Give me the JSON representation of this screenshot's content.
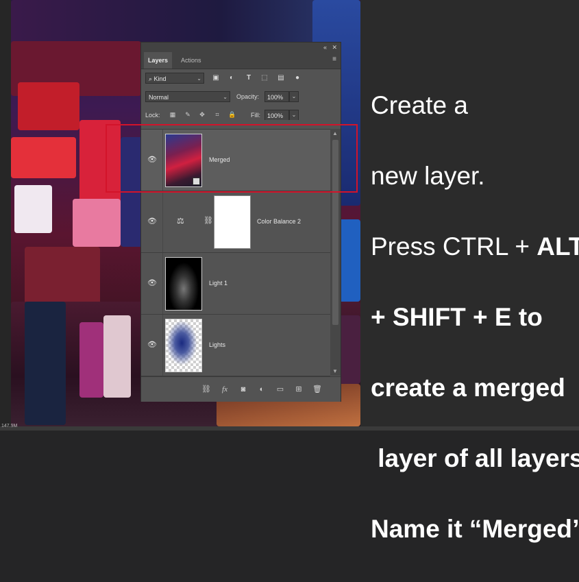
{
  "panel": {
    "tabs": [
      {
        "label": "Layers",
        "active": true
      },
      {
        "label": "Actions",
        "active": false
      }
    ],
    "filter": {
      "kind_label": "Kind"
    },
    "blend": {
      "mode": "Normal",
      "opacity_label": "Opacity:",
      "opacity_value": "100%"
    },
    "lock": {
      "label": "Lock:",
      "fill_label": "Fill:",
      "fill_value": "100%"
    },
    "layers": [
      {
        "name": "Merged",
        "selected": true,
        "visible": true
      },
      {
        "name": "Color Balance 2",
        "selected": false,
        "visible": true
      },
      {
        "name": "Light 1",
        "selected": false,
        "visible": true
      },
      {
        "name": "Lights",
        "selected": false,
        "visible": true
      }
    ],
    "bottom_icons": [
      "link-icon",
      "fx-icon",
      "mask-icon",
      "adjustment-icon",
      "folder-icon",
      "new-layer-icon",
      "trash-icon"
    ]
  },
  "instructions": {
    "line1": "Create a",
    "line2": "new layer.",
    "line3a": "Press CTRL + ",
    "line3b": "ALT",
    "line4": "+ SHIFT + E to",
    "line5": "create a merged",
    "line6": " layer of all layers.",
    "line7": "Name it “Merged”"
  },
  "status": {
    "text": "147.9M"
  },
  "colors": {
    "highlight": "#d3132a",
    "panel_bg": "#535353",
    "text": "#ffffff"
  }
}
